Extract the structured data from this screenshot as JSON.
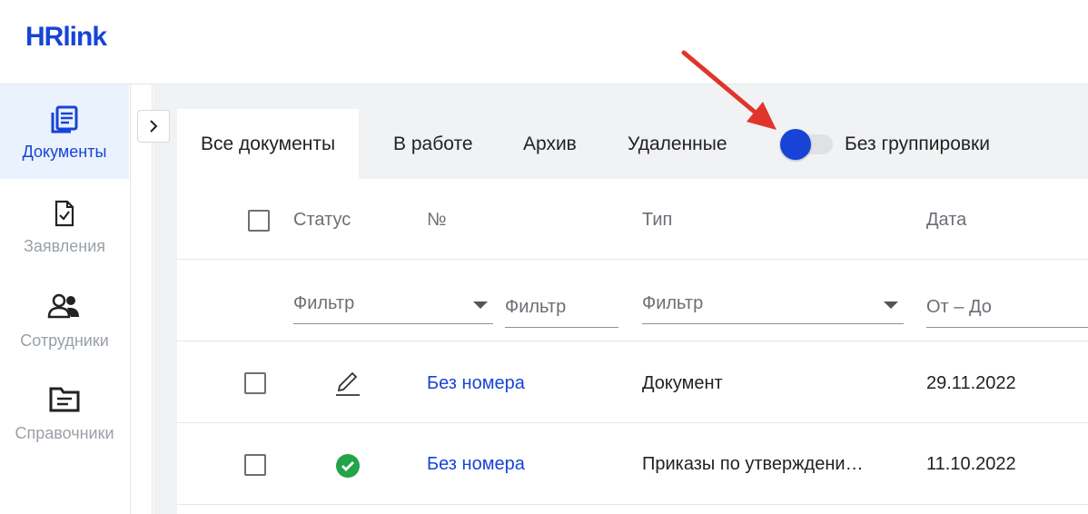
{
  "app": {
    "logo_text": "HRlink"
  },
  "sidebar": {
    "items": [
      {
        "label": "Документы",
        "icon": "documents-icon",
        "active": true
      },
      {
        "label": "Заявления",
        "icon": "application-check-icon",
        "active": false
      },
      {
        "label": "Сотрудники",
        "icon": "employees-icon",
        "active": false
      },
      {
        "label": "Справочники",
        "icon": "folder-icon",
        "active": false
      }
    ]
  },
  "tabs": [
    {
      "label": "Все документы",
      "active": true
    },
    {
      "label": "В работе",
      "active": false
    },
    {
      "label": "Архив",
      "active": false
    },
    {
      "label": "Удаленные",
      "active": false
    }
  ],
  "grouping_toggle": {
    "label": "Без группировки",
    "on": true
  },
  "table": {
    "columns": [
      "Статус",
      "№",
      "Тип",
      "Дата"
    ],
    "filters": {
      "status": "Фильтр",
      "number": "Фильтр",
      "type": "Фильтр",
      "date": "От – До"
    },
    "rows": [
      {
        "status_icon": "edit-pencil-icon",
        "number": "Без номера",
        "type": "Документ",
        "date": "29.11.2022"
      },
      {
        "status_icon": "check-circle-icon",
        "number": "Без номера",
        "type": "Приказы по утверждени…",
        "date": "11.10.2022"
      }
    ]
  },
  "colors": {
    "accent": "#1744d6",
    "success": "#22a447",
    "annotation_arrow": "#e0352b"
  }
}
